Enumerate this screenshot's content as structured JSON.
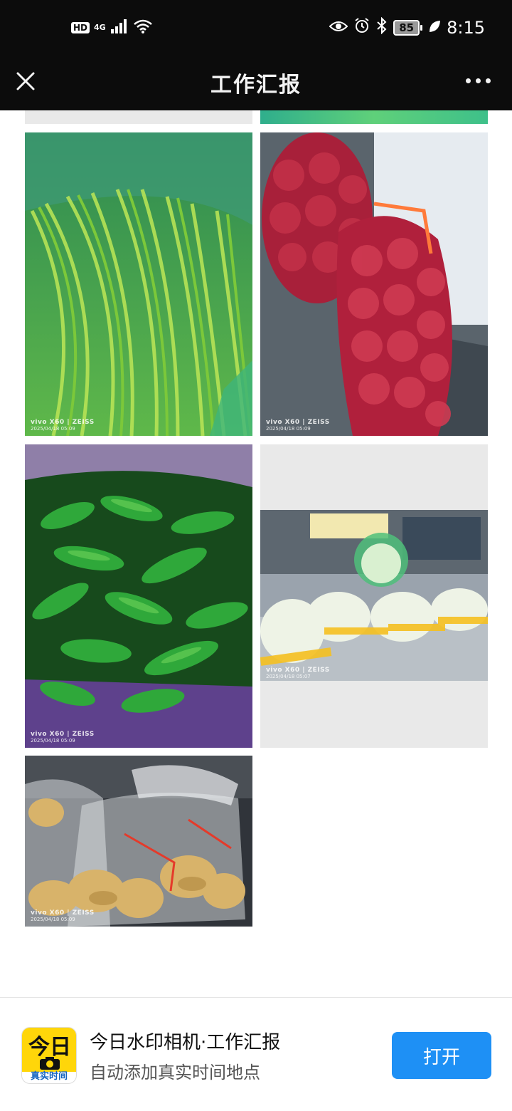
{
  "status_bar": {
    "hd": "HD",
    "network": "4G",
    "battery": "85",
    "time": "8:15"
  },
  "title_bar": {
    "title": "工作汇报"
  },
  "photos": [
    {
      "watermark_brand": "vivo X60 | ZEISS",
      "watermark_time": "2025/04/18 05:09"
    },
    {
      "watermark_brand": "vivo X60 | ZEISS",
      "watermark_time": "2025/04/18 05:09"
    },
    {
      "watermark_brand": "vivo X60 | ZEISS",
      "watermark_time": "2025/04/18 05:09"
    },
    {
      "watermark_brand": "vivo X60 | ZEISS",
      "watermark_time": "2025/04/18 05:07"
    },
    {
      "watermark_brand": "vivo X60 | ZEISS",
      "watermark_time": "2025/04/18 05:09"
    }
  ],
  "banner": {
    "logo_main": "今日",
    "logo_sub": "真实时间",
    "app_name": "今日水印相机·工作汇报",
    "app_desc": "自动添加真实时间地点",
    "open_label": "打开"
  },
  "colors": {
    "bar_bg": "#0c0c0c",
    "button_blue": "#1e90f5",
    "logo_yellow": "#ffd60a"
  }
}
